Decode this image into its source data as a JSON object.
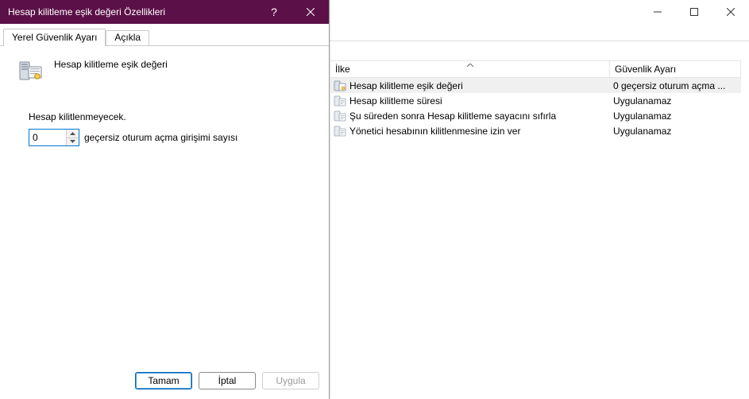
{
  "parent_window": {
    "columns": {
      "policy": "İlke",
      "setting": "Güvenlik Ayarı"
    },
    "rows": [
      {
        "label": "Hesap kilitleme eşik değeri",
        "value": "0 geçersiz oturum açma ...",
        "selected": true,
        "icon": "threshold"
      },
      {
        "label": "Hesap kilitleme süresi",
        "value": "Uygulanamaz",
        "selected": false,
        "icon": "generic"
      },
      {
        "label": "Şu süreden sonra Hesap kilitleme sayacını sıfırla",
        "value": "Uygulanamaz",
        "selected": false,
        "icon": "generic"
      },
      {
        "label": "Yönetici hesabının kilitlenmesine izin ver",
        "value": "Uygulanamaz",
        "selected": false,
        "icon": "generic"
      }
    ]
  },
  "dialog": {
    "title": "Hesap kilitleme eşik değeri Özellikleri",
    "tabs": {
      "local": "Yerel Güvenlik Ayarı",
      "explain": "Açıkla"
    },
    "policy_name": "Hesap kilitleme eşik değeri",
    "hint": "Hesap kilitlenmeyecek.",
    "spinner_value": "0",
    "spinner_caption": "geçersiz oturum açma girişimi sayısı",
    "buttons": {
      "ok": "Tamam",
      "cancel": "İptal",
      "apply": "Uygula"
    }
  }
}
